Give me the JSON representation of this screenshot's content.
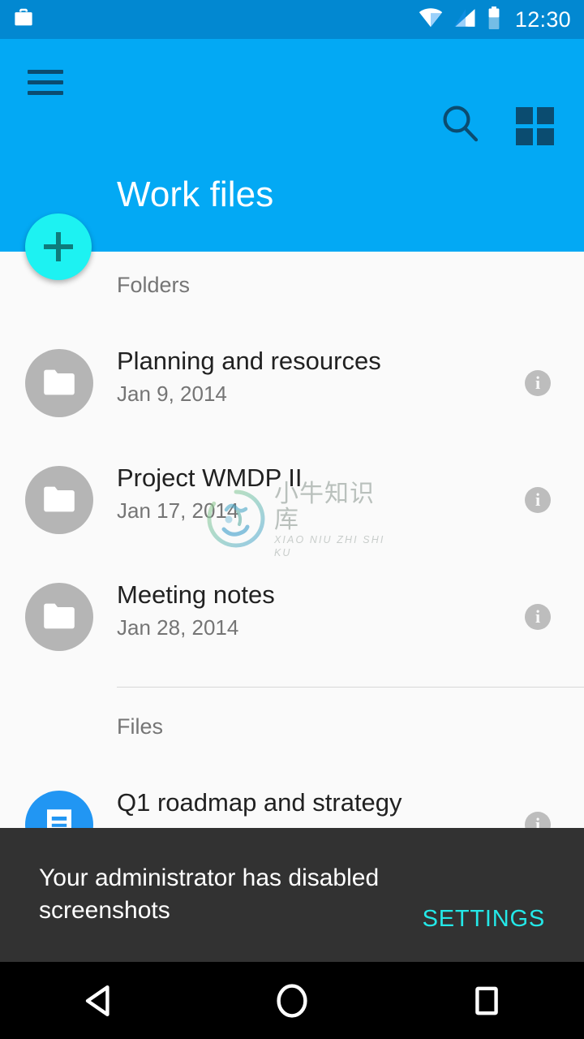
{
  "status_bar": {
    "work_profile_icon": "briefcase-icon",
    "wifi_icon": "wifi-icon",
    "signal_icon": "cellular-signal-icon",
    "battery_icon": "battery-icon",
    "clock": "12:30",
    "background_color": "#0288D1"
  },
  "app_bar": {
    "title": "Work files",
    "menu_icon": "hamburger-menu-icon",
    "search_icon": "search-icon",
    "grid_icon": "grid-view-icon",
    "background_color": "#03A9F4",
    "icon_color": "#0B4C70",
    "title_color": "#FFFFFF"
  },
  "fab": {
    "label": "+",
    "icon": "plus-icon",
    "background_color": "#1DF2F2",
    "icon_color": "#0E7C7C"
  },
  "content": {
    "background_color": "#FAFAFA",
    "sections": [
      {
        "header": "Folders",
        "items": [
          {
            "title": "Planning and resources",
            "subtitle": "Jan 9, 2014",
            "avatar_icon": "folder-icon",
            "avatar_color": "#B5B5B5",
            "info_icon": "info-icon"
          },
          {
            "title": "Project WMDP II",
            "subtitle": "Jan 17, 2014",
            "avatar_icon": "folder-icon",
            "avatar_color": "#B5B5B5",
            "info_icon": "info-icon"
          },
          {
            "title": "Meeting notes",
            "subtitle": "Jan 28, 2014",
            "avatar_icon": "folder-icon",
            "avatar_color": "#B5B5B5",
            "info_icon": "info-icon"
          }
        ]
      },
      {
        "header": "Files",
        "items": [
          {
            "title": "Q1 roadmap and strategy",
            "subtitle": "",
            "avatar_icon": "document-icon",
            "avatar_color": "#2196F3",
            "info_icon": "info-icon"
          }
        ]
      }
    ]
  },
  "watermark": {
    "chinese": "小牛知识库",
    "pinyin": "XIAO NIU ZHI SHI KU",
    "logo_icon": "circular-ox-logo-icon"
  },
  "snackbar": {
    "message": "Your administrator has disabled screenshots",
    "action_label": "SETTINGS",
    "background_color": "#323232",
    "action_color": "#24E8E8"
  },
  "nav_bar": {
    "back_icon": "back-triangle-icon",
    "home_icon": "home-circle-icon",
    "recents_icon": "recents-square-icon",
    "background_color": "#000000"
  }
}
